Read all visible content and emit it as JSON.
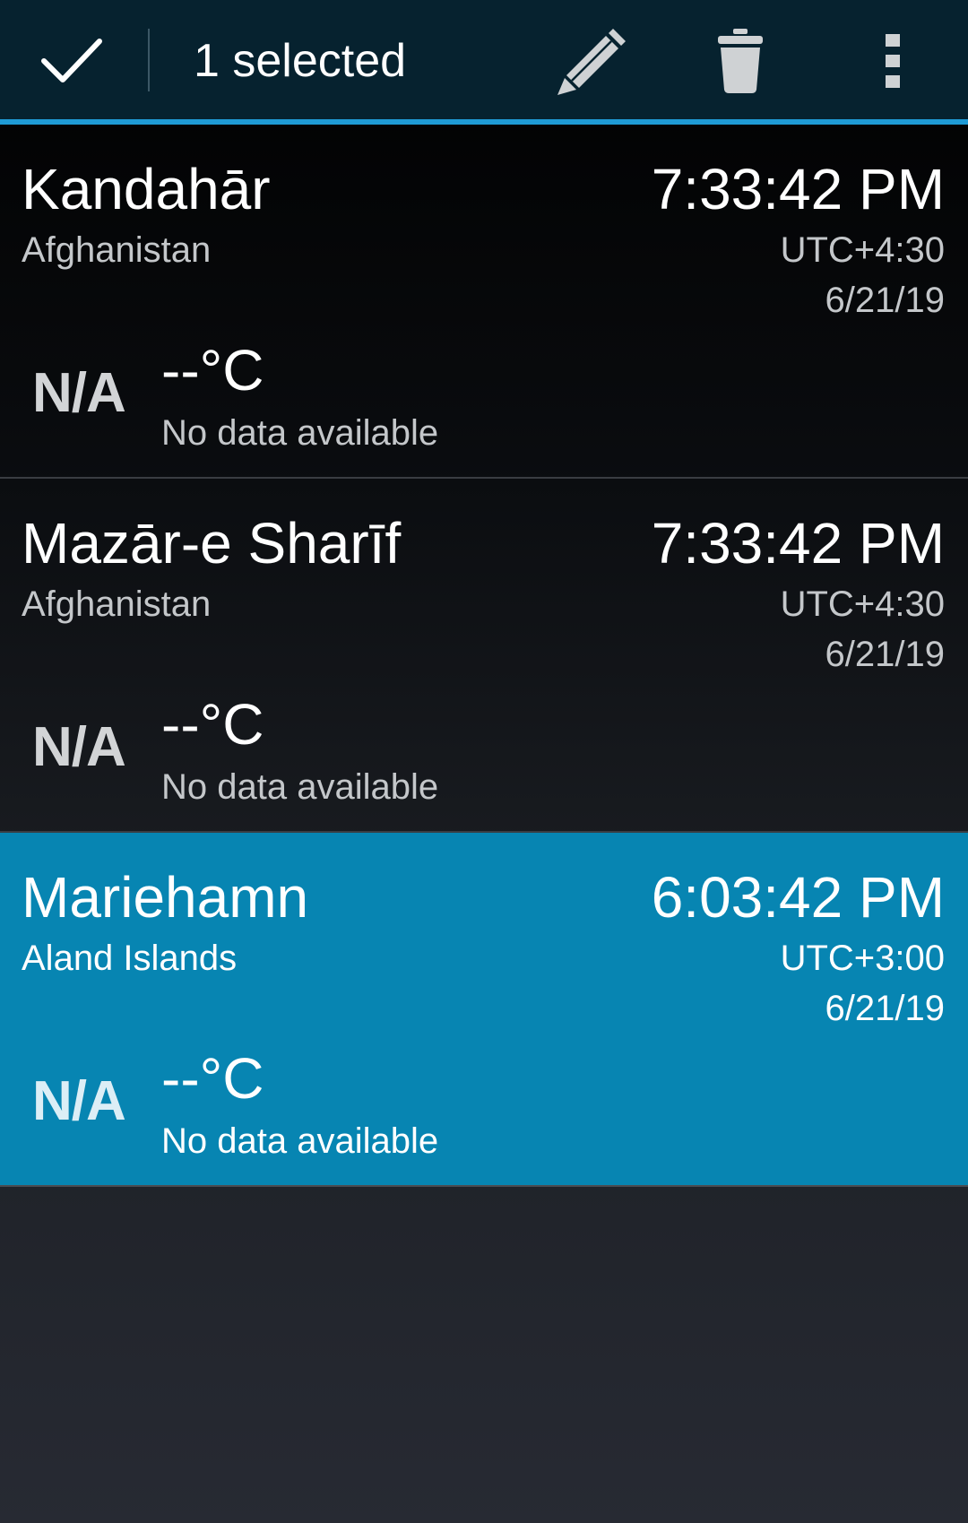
{
  "action_bar": {
    "selected_text": "1 selected",
    "icons": [
      "check-icon",
      "pencil-icon",
      "trash-icon",
      "overflow-menu-icon"
    ],
    "background_color": "#06222f",
    "accent_color": "#1f9bd6"
  },
  "cities": [
    {
      "name": "Kandahār",
      "country": "Afghanistan",
      "time": "7:33:42 PM",
      "utc_offset": "UTC+4:30",
      "date": "6/21/19",
      "weather_icon": "N/A",
      "temperature": "--°C",
      "weather_description": "No data available",
      "selected": false
    },
    {
      "name": "Mazār-e Sharīf",
      "country": "Afghanistan",
      "time": "7:33:42 PM",
      "utc_offset": "UTC+4:30",
      "date": "6/21/19",
      "weather_icon": "N/A",
      "temperature": "--°C",
      "weather_description": "No data available",
      "selected": false
    },
    {
      "name": "Mariehamn",
      "country": "Aland Islands",
      "time": "6:03:42 PM",
      "utc_offset": "UTC+3:00",
      "date": "6/21/19",
      "weather_icon": "N/A",
      "temperature": "--°C",
      "weather_description": "No data available",
      "selected": true
    }
  ],
  "colors": {
    "selected_row": "#0785b2"
  }
}
